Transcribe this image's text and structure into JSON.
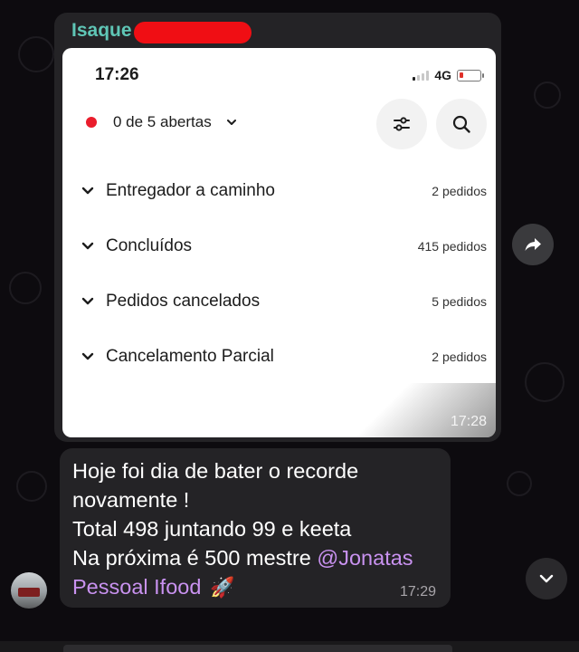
{
  "chat": {
    "image_message": {
      "sender": "Isaque",
      "timestamp": "17:28",
      "screenshot": {
        "status_time": "17:26",
        "network": "4G",
        "filter_label": "0 de 5 abertas",
        "sections": [
          {
            "label": "Entregador a caminho",
            "count": "2 pedidos"
          },
          {
            "label": "Concluídos",
            "count": "415 pedidos"
          },
          {
            "label": "Pedidos cancelados",
            "count": "5 pedidos"
          },
          {
            "label": "Cancelamento Parcial",
            "count": "2 pedidos"
          }
        ]
      }
    },
    "text_message": {
      "line1": "Hoje foi dia de bater o recorde",
      "line2": "novamente !",
      "line3": "Total 498 juntando 99 e keeta",
      "line4_prefix": "Na próxima é 500 mestre ",
      "mention_part1": "@Jonatas",
      "mention_part2": "Pessoal Ifood",
      "emoji": "🚀",
      "timestamp": "17:29"
    }
  },
  "colors": {
    "sender_name": "#5fc6b6",
    "mention": "#c992f0",
    "redaction": "#f00e14",
    "status_dot": "#ea1d2c",
    "bubble": "#242326"
  },
  "icons": [
    "share-forward-icon",
    "filter-sliders-icon",
    "search-icon",
    "chevron-down-icon",
    "scroll-down-icon"
  ]
}
